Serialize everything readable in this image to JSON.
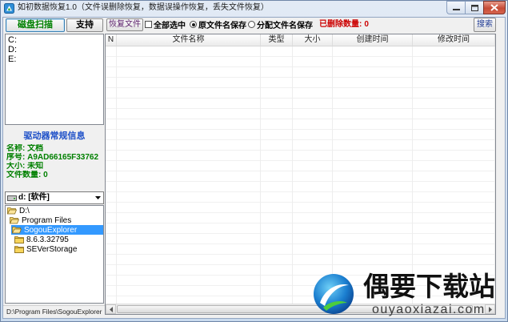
{
  "window": {
    "title": "如初数据恢复1.0（文件误删除恢复，数据误操作恢复，丢失文件恢复）",
    "icons": {
      "app": "app-icon",
      "minimize": "minimize-icon",
      "maximize": "maximize-icon",
      "close": "close-icon"
    }
  },
  "colors": {
    "scan_text": "#008000",
    "info_title": "#1e50c8",
    "info_text": "#008000",
    "deleted_count": "#cc0000",
    "selection": "#3399ff",
    "restore_text": "#5b1f6b",
    "search_text": "#1f3a93"
  },
  "left": {
    "scan_button": "磁盘扫描",
    "support_button": "支持",
    "drives": [
      "C:",
      "D:",
      "E:"
    ],
    "info": {
      "title": "驱动器常规信息",
      "lines": [
        "名称: 文档",
        "序号: A9AD66165F33762",
        "大小: 未知",
        "文件数量: 0"
      ]
    },
    "drive_select": {
      "value": "d: [软件]",
      "icon": "drive-icon"
    },
    "tree": [
      {
        "label": "D:\\",
        "level": 0,
        "icon": "folder-open-icon",
        "selected": false
      },
      {
        "label": "Program Files",
        "level": 1,
        "icon": "folder-open-icon",
        "selected": false
      },
      {
        "label": "SogouExplorer",
        "level": 2,
        "icon": "folder-open-icon",
        "selected": true
      },
      {
        "label": "8.6.3.32795",
        "level": 3,
        "icon": "folder-icon",
        "selected": false
      },
      {
        "label": "SEVerStorage",
        "level": 3,
        "icon": "folder-icon",
        "selected": false
      }
    ],
    "status_path": "D:\\Program Files\\SogouExplorer"
  },
  "toolbar": {
    "restore_button": "恢复文件",
    "select_all": {
      "label": "全部选中",
      "checked": false
    },
    "save_mode": {
      "options": [
        {
          "label": "原文件名保存",
          "selected": true
        },
        {
          "label": "分配文件名保存",
          "selected": false
        }
      ]
    },
    "deleted_count": {
      "label": "已删除数量:",
      "value": "0"
    },
    "search_button": "搜索"
  },
  "table": {
    "columns": [
      "N",
      "文件名称",
      "类型",
      "大小",
      "创建时间",
      "修改时间"
    ],
    "rows": []
  },
  "watermark": {
    "name": "偶要下载站",
    "url": "ouyaoxiazai.com"
  }
}
